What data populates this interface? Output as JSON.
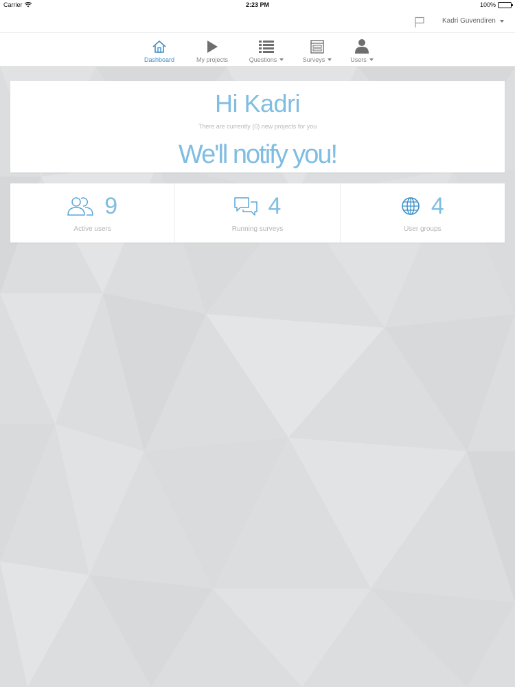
{
  "status_bar": {
    "carrier": "Carrier",
    "time": "2:23 PM",
    "battery": "100%"
  },
  "header": {
    "user_name": "Kadri Guvendiren"
  },
  "nav": {
    "items": [
      {
        "label": "Dashboard",
        "icon": "home-icon",
        "active": true
      },
      {
        "label": "My projects",
        "icon": "play-icon",
        "active": false
      },
      {
        "label": "Questions",
        "icon": "list-icon",
        "active": false,
        "dropdown": true
      },
      {
        "label": "Surveys",
        "icon": "survey-icon",
        "active": false,
        "dropdown": true
      },
      {
        "label": "Users",
        "icon": "user-icon",
        "active": false,
        "dropdown": true
      }
    ]
  },
  "welcome": {
    "greeting": "Hi Kadri",
    "subtext": "There are currently (0) new projects for you",
    "notify": "We'll notify you!"
  },
  "stats": [
    {
      "value": "9",
      "label": "Active users",
      "icon": "users-icon"
    },
    {
      "value": "4",
      "label": "Running surveys",
      "icon": "chat-bubbles-icon"
    },
    {
      "value": "4",
      "label": "User groups",
      "icon": "globe-icon"
    }
  ],
  "colors": {
    "accent": "#3b8fc7",
    "accent_light": "#7fbde2",
    "background": "#dcdddf",
    "nav_icon": "#6e6e6e"
  }
}
